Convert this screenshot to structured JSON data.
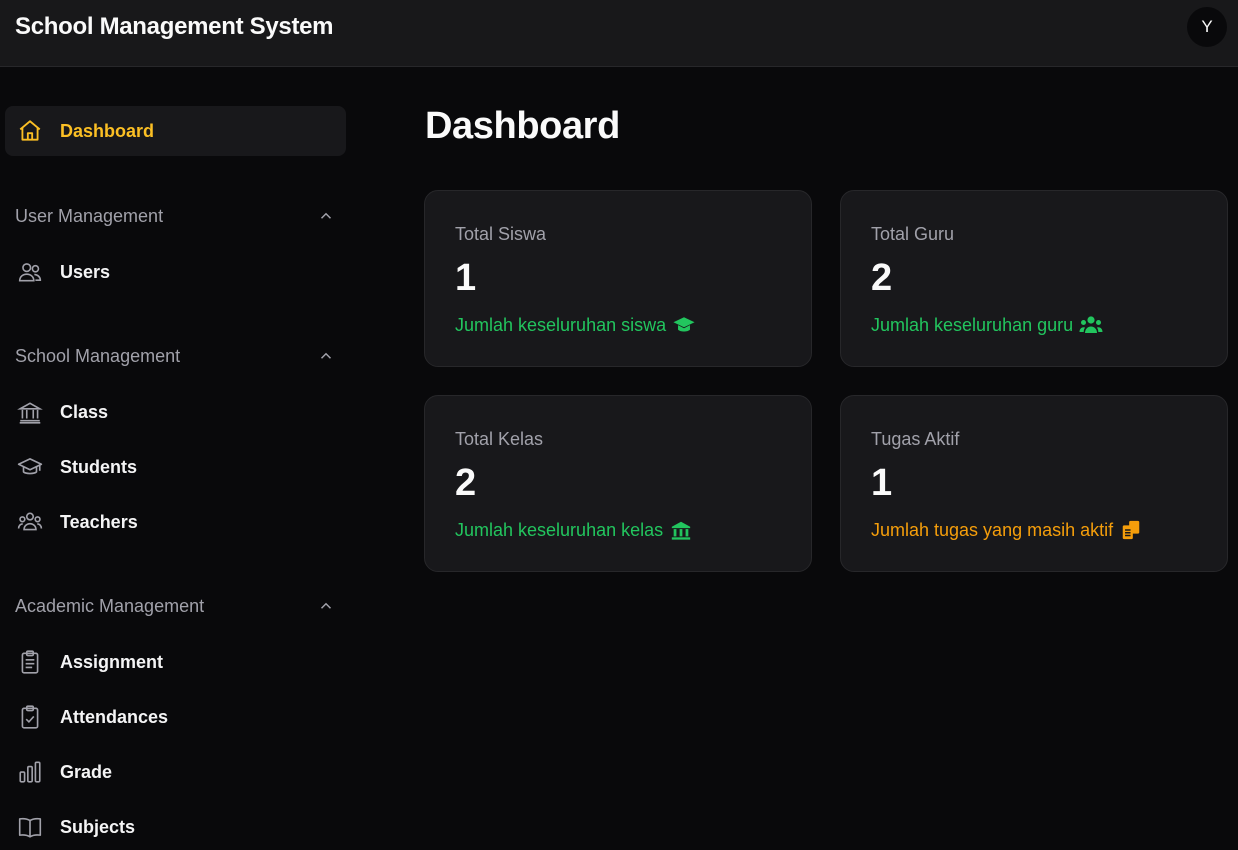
{
  "app": {
    "title": "School Management System",
    "avatar_initial": "Y"
  },
  "colors": {
    "accent": "#fbbf24",
    "positive": "#22c55e",
    "warning": "#f59e0b",
    "background": "#09090b",
    "card": "#18181b"
  },
  "sidebar": {
    "dashboard": {
      "label": "Dashboard",
      "icon": "home-icon"
    },
    "sections": [
      {
        "title": "User Management",
        "items": [
          {
            "label": "Users",
            "icon": "users-icon"
          }
        ]
      },
      {
        "title": "School Management",
        "items": [
          {
            "label": "Class",
            "icon": "bank-icon"
          },
          {
            "label": "Students",
            "icon": "graduation-cap-icon"
          },
          {
            "label": "Teachers",
            "icon": "teachers-icon"
          }
        ]
      },
      {
        "title": "Academic Management",
        "items": [
          {
            "label": "Assignment",
            "icon": "clipboard-list-icon"
          },
          {
            "label": "Attendances",
            "icon": "clipboard-check-icon"
          },
          {
            "label": "Grade",
            "icon": "bar-chart-icon"
          },
          {
            "label": "Subjects",
            "icon": "book-icon"
          }
        ]
      }
    ]
  },
  "main": {
    "title": "Dashboard",
    "cards": [
      {
        "title": "Total Siswa",
        "value": "1",
        "desc": "Jumlah keseluruhan siswa",
        "icon": "graduation-cap-icon"
      },
      {
        "title": "Total Guru",
        "value": "2",
        "desc": "Jumlah keseluruhan guru",
        "icon": "users-icon"
      },
      {
        "title": "Total Kelas",
        "value": "2",
        "desc": "Jumlah keseluruhan kelas",
        "icon": "bank-icon"
      },
      {
        "title": "Tugas Aktif",
        "value": "1",
        "desc": "Jumlah tugas yang masih aktif",
        "icon": "copy-icon"
      }
    ]
  }
}
